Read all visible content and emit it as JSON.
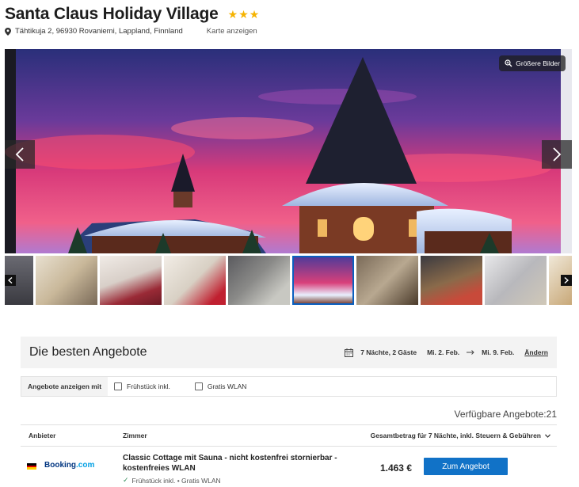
{
  "hotel": {
    "name": "Santa Claus Holiday Village",
    "stars": "★★★",
    "address": "Tähtikuja 2, 96930 Rovaniemi, Lappland, Finnland",
    "map_link": "Karte anzeigen"
  },
  "gallery": {
    "bigger_images_label": "Größere Bilder",
    "thumbnail_count": 10,
    "active_thumbnail_index": 5
  },
  "offers": {
    "title": "Die besten Angebote",
    "stay": "7 Nächte, 2 Gäste",
    "checkin": "Mi. 2. Feb.",
    "checkout": "Mi. 9. Feb.",
    "change_label": "Ändern",
    "filter_label": "Angebote anzeigen mit",
    "filters": [
      "Frühstück inkl.",
      "Gratis WLAN"
    ],
    "available_count": "Verfügbare Angebote:21",
    "columns": {
      "provider": "Anbieter",
      "room": "Zimmer",
      "total": "Gesamtbetrag für 7 Nächte, inkl. Steuern & Gebühren"
    },
    "rows": [
      {
        "provider_main": "Booking",
        "provider_suffix": ".com",
        "room_name": "Classic Cottage mit Sauna - nicht kostenfrei stornierbar - kostenfreies WLAN",
        "features": "Frühstück inkl. • Gratis WLAN",
        "price": "1.463 €",
        "cta": "Zum Angebot"
      }
    ]
  },
  "colors": {
    "accent": "#1172c7",
    "stars": "#f5b301",
    "booking_blue": "#003580"
  }
}
